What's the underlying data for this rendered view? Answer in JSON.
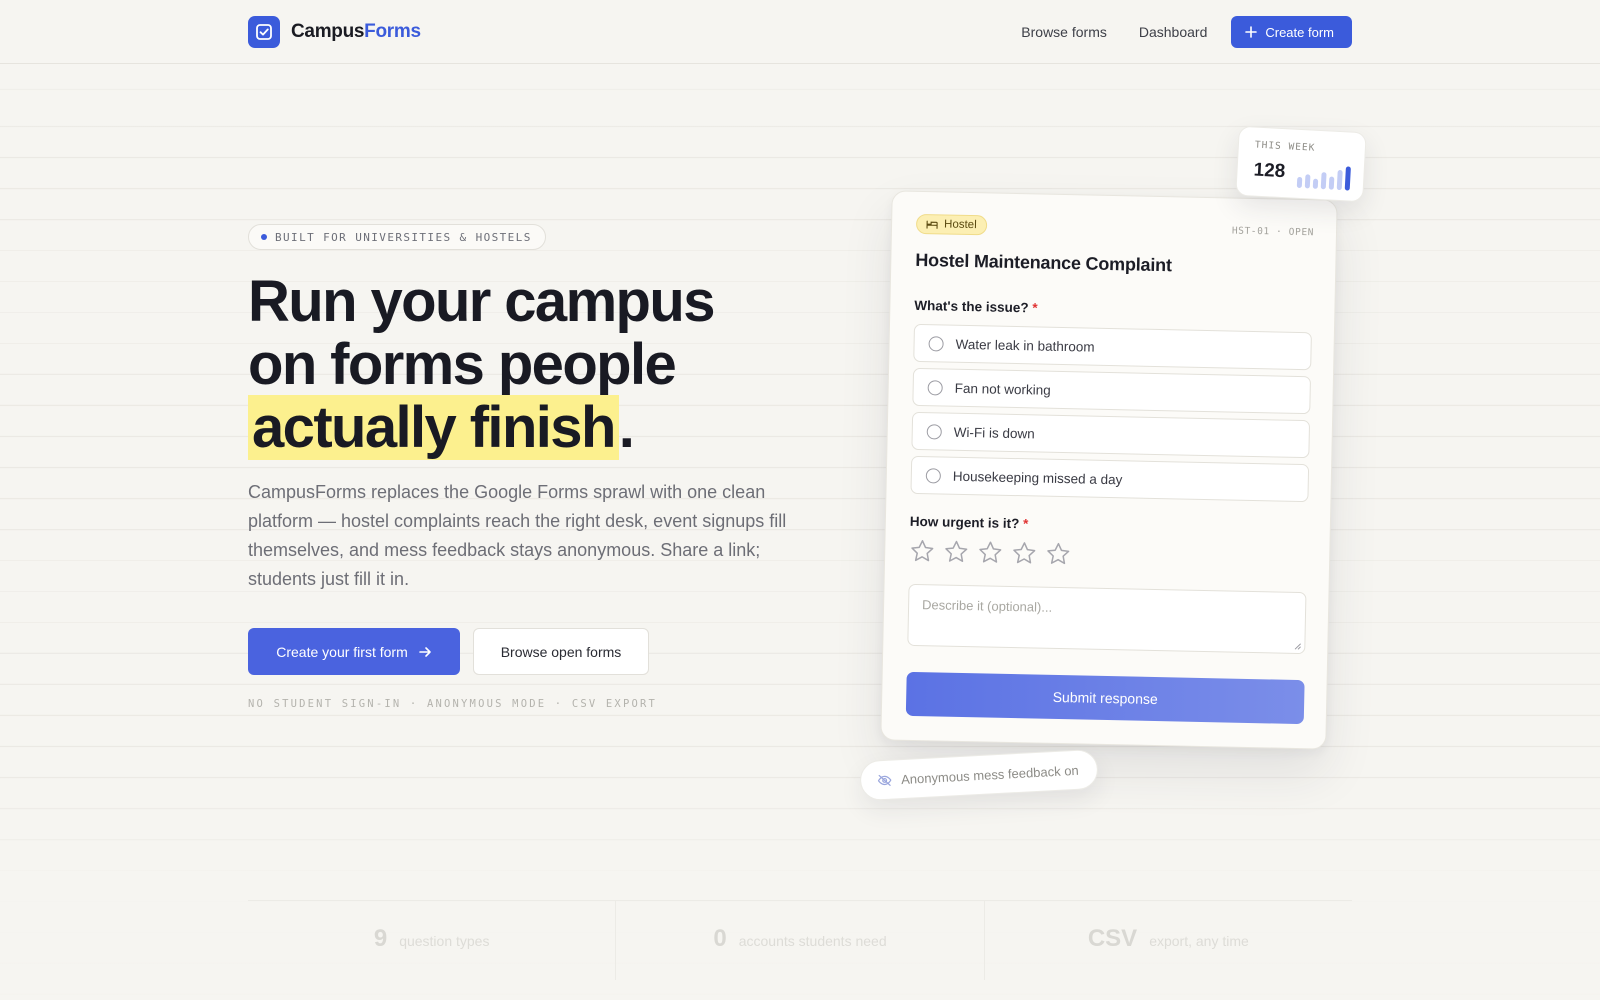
{
  "brand": {
    "name_part1": "Campus",
    "name_part2": "Forms"
  },
  "nav": {
    "browse": "Browse forms",
    "dashboard": "Dashboard",
    "create": "Create form"
  },
  "hero": {
    "pill": "BUILT FOR UNIVERSITIES & HOSTELS",
    "headline_line1": "Run your campus",
    "headline_line2": "on forms people",
    "headline_highlight": "actually finish",
    "headline_period": ".",
    "lede": "CampusForms replaces the Google Forms sprawl with one clean platform — hostel complaints reach the right desk, event signups fill themselves, and mess feedback stays anonymous. Share a link; students just fill it in.",
    "cta_primary": "Create your first form",
    "cta_secondary": "Browse open forms",
    "features": "NO STUDENT SIGN-IN · ANONYMOUS MODE · CSV EXPORT"
  },
  "form_card": {
    "tag": "Hostel",
    "code": "HST-01 · OPEN",
    "title": "Hostel Maintenance Complaint",
    "q1": "What's the issue?",
    "q1_required": "*",
    "options": [
      "Water leak in bathroom",
      "Fan not working",
      "Wi-Fi is down",
      "Housekeeping missed a day"
    ],
    "q2": "How urgent is it?",
    "q2_required": "*",
    "rating_max": 5,
    "rating_value": 0,
    "textarea_placeholder": "Describe it (optional)...",
    "submit": "Submit response"
  },
  "week_card": {
    "label": "THIS WEEK",
    "value": "128",
    "bars": [
      0.45,
      0.6,
      0.4,
      0.7,
      0.55,
      0.85,
      1.0
    ]
  },
  "anon_chip": {
    "text": "Anonymous mess feedback on"
  },
  "stats": [
    {
      "num": "9",
      "label": "question types"
    },
    {
      "num": "0",
      "label": "accounts students need"
    },
    {
      "num": "CSV",
      "label": "export, any time"
    }
  ],
  "colors": {
    "accent": "#3b5bdb",
    "highlight": "#fcf08e",
    "required": "#e03131"
  }
}
